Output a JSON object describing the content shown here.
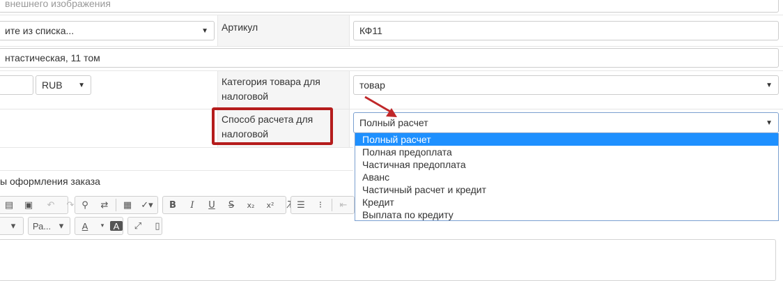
{
  "form": {
    "image_field_placeholder": "внешнего изображения",
    "manufacturer_select": "ите из списка...",
    "article_label": "Артикул",
    "article_value": "КФ11",
    "address_value": "нтастическая, 11 том",
    "currency": "RUB",
    "tax_category_label": "Категория товара для налоговой",
    "tax_category_value": "товар",
    "payment_method_label": "Способ расчета для налоговой",
    "payment_method_value": "Полный расчет",
    "payment_options": [
      "Полный расчет",
      "Полная предоплата",
      "Частичная предоплата",
      "Аванс",
      "Частичный расчет и кредит",
      "Кредит",
      "Выплата по кредиту"
    ],
    "order_section_label": "ы оформления заказа"
  },
  "editor": {
    "format_select": "Ра...",
    "bold": "B",
    "italic": "I",
    "underline": "U",
    "strike": "S",
    "subscript": "x₂",
    "superscript": "x²",
    "text_color": "A",
    "bg_color": "A"
  },
  "colors": {
    "highlight_border": "#b51c1c",
    "arrow": "#c0282a",
    "selected_option": "#1e90ff",
    "focus_border": "#7a9fd0"
  }
}
